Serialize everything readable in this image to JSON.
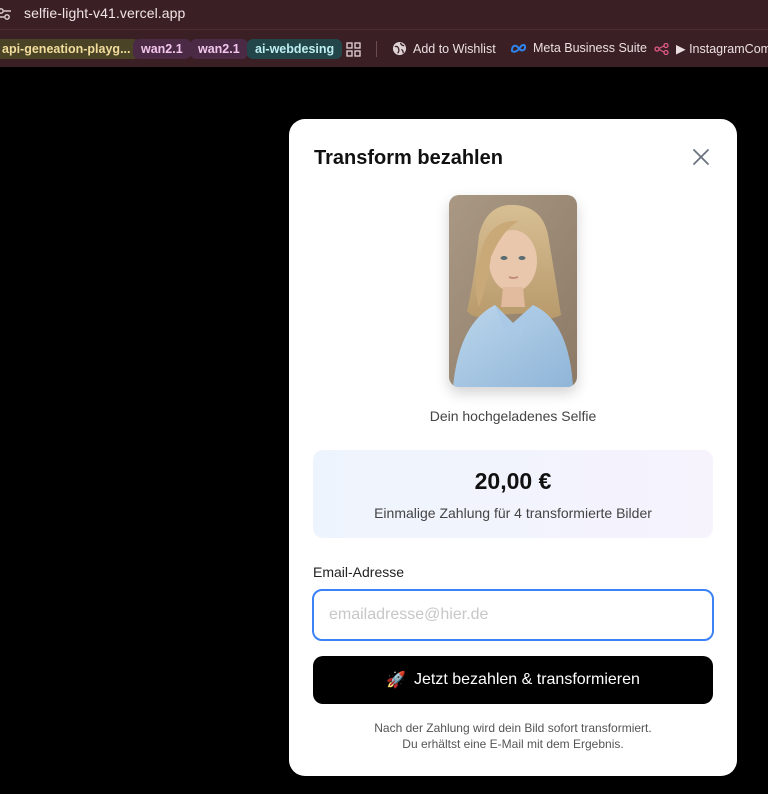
{
  "browser": {
    "url": "selfie-light-v41.vercel.app",
    "bookmarks": [
      {
        "label": "api-geneation-playg..."
      },
      {
        "label": "wan2.1"
      },
      {
        "label": "wan2.1"
      },
      {
        "label": "ai-webdesing"
      }
    ],
    "links": [
      {
        "label": "Add to Wishlist",
        "icon": "globe-icon"
      },
      {
        "label": "Meta Business Suite",
        "icon": "meta-icon"
      },
      {
        "label": "▶ InstagramCom",
        "icon": "share-icon"
      }
    ]
  },
  "modal": {
    "title": "Transform bezahlen",
    "selfie_caption": "Dein hochgeladenes Selfie",
    "price": "20,00 €",
    "price_description": "Einmalige Zahlung für 4 transformierte Bilder",
    "email_label": "Email-Adresse",
    "email_placeholder": "emailadresse@hier.de",
    "pay_button": "Jetzt bezahlen & transformieren",
    "footnote_line1": "Nach der Zahlung wird dein Bild sofort transformiert.",
    "footnote_line2": "Du erhältst eine E-Mail mit dem Ergebnis."
  },
  "colors": {
    "chrome_bg": "#3a2024",
    "accent_blue": "#3b82f6",
    "button_bg": "#000000"
  }
}
